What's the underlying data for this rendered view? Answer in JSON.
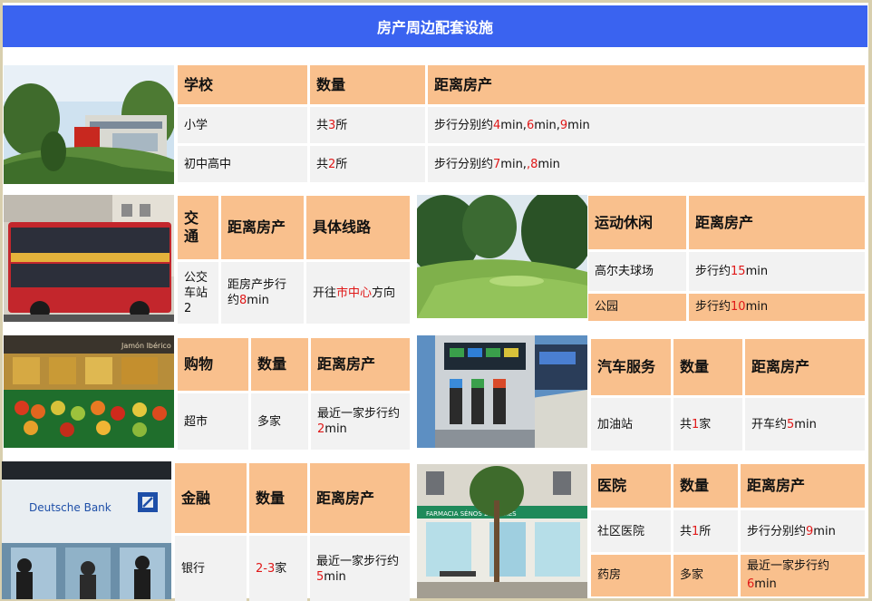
{
  "title": "房产周边配套设施",
  "school": {
    "headers": [
      "学校",
      "数量",
      "距离房产"
    ],
    "rows": [
      {
        "type": "小学",
        "count_pre": "共",
        "count_num": "3",
        "count_post": "所",
        "dist_pre": "步行分别约",
        "dist_a": "4",
        "dist_b": "min,",
        "dist_c": "6",
        "dist_d": "min,",
        "dist_e": "9",
        "dist_f": "min"
      },
      {
        "type": "初中高中",
        "count_pre": "共",
        "count_num": "2",
        "count_post": "所",
        "dist_pre": "步行分别约",
        "dist_a": "7",
        "dist_b": "min,",
        "dist_c": ",8",
        "dist_d": "min"
      }
    ]
  },
  "transport": {
    "headers": [
      "交通",
      "距离房产",
      "具体线路"
    ],
    "row": {
      "type": "公交车站2",
      "dist_pre": "距房产步行约",
      "dist_num": "8",
      "dist_post": "min",
      "route_pre": "开往",
      "route_hl": "市中心",
      "route_post": "方向"
    }
  },
  "sport": {
    "headers": [
      "运动休闲",
      "距离房产"
    ],
    "rows": [
      {
        "type": "高尔夫球场",
        "dist_pre": "步行约",
        "dist_num": "15",
        "dist_post": "min"
      },
      {
        "type": "公园",
        "dist_pre": "步行约",
        "dist_num": "10",
        "dist_post": "min"
      }
    ]
  },
  "shopping": {
    "headers": [
      "购物",
      "数量",
      "距离房产"
    ],
    "row": {
      "type": "超市",
      "count": "多家",
      "dist_pre": "最近一家步行约",
      "dist_num": "2",
      "dist_post": "min"
    }
  },
  "auto": {
    "headers": [
      "汽车服务",
      "数量",
      "距离房产"
    ],
    "row": {
      "type": "加油站",
      "count_pre": "共",
      "count_num": "1",
      "count_post": "家",
      "dist_pre": "开车约",
      "dist_num": "5",
      "dist_post": "min"
    }
  },
  "finance": {
    "headers": [
      "金融",
      "数量",
      "距离房产"
    ],
    "row": {
      "type": "银行",
      "count_num": "2-3",
      "count_post": "家",
      "dist_pre": "最近一家步行约",
      "dist_num": "5",
      "dist_post": "min"
    }
  },
  "hospital": {
    "headers": [
      "医院",
      "数量",
      "距离房产"
    ],
    "rows": [
      {
        "type": "社区医院",
        "count_pre": "共",
        "count_num": "1",
        "count_post": "所",
        "dist_pre": "步行分别约",
        "dist_num": "9",
        "dist_post": "min"
      },
      {
        "type": "药房",
        "count": "多家",
        "dist_pre": "最近一家步行约",
        "dist_num": "6",
        "dist_post": "min"
      }
    ]
  },
  "photos": {
    "bank_sign": "Deutsche Bank",
    "pharmacy_sign": "FARMACIA  SÉNOS  24 HORES",
    "store_sign": "Jamón Ibérico"
  },
  "colors": {
    "banner": "#3a63f0",
    "header_cell": "#f9c08d",
    "body_cell": "#f2f2f2",
    "highlight": "#e01818"
  }
}
